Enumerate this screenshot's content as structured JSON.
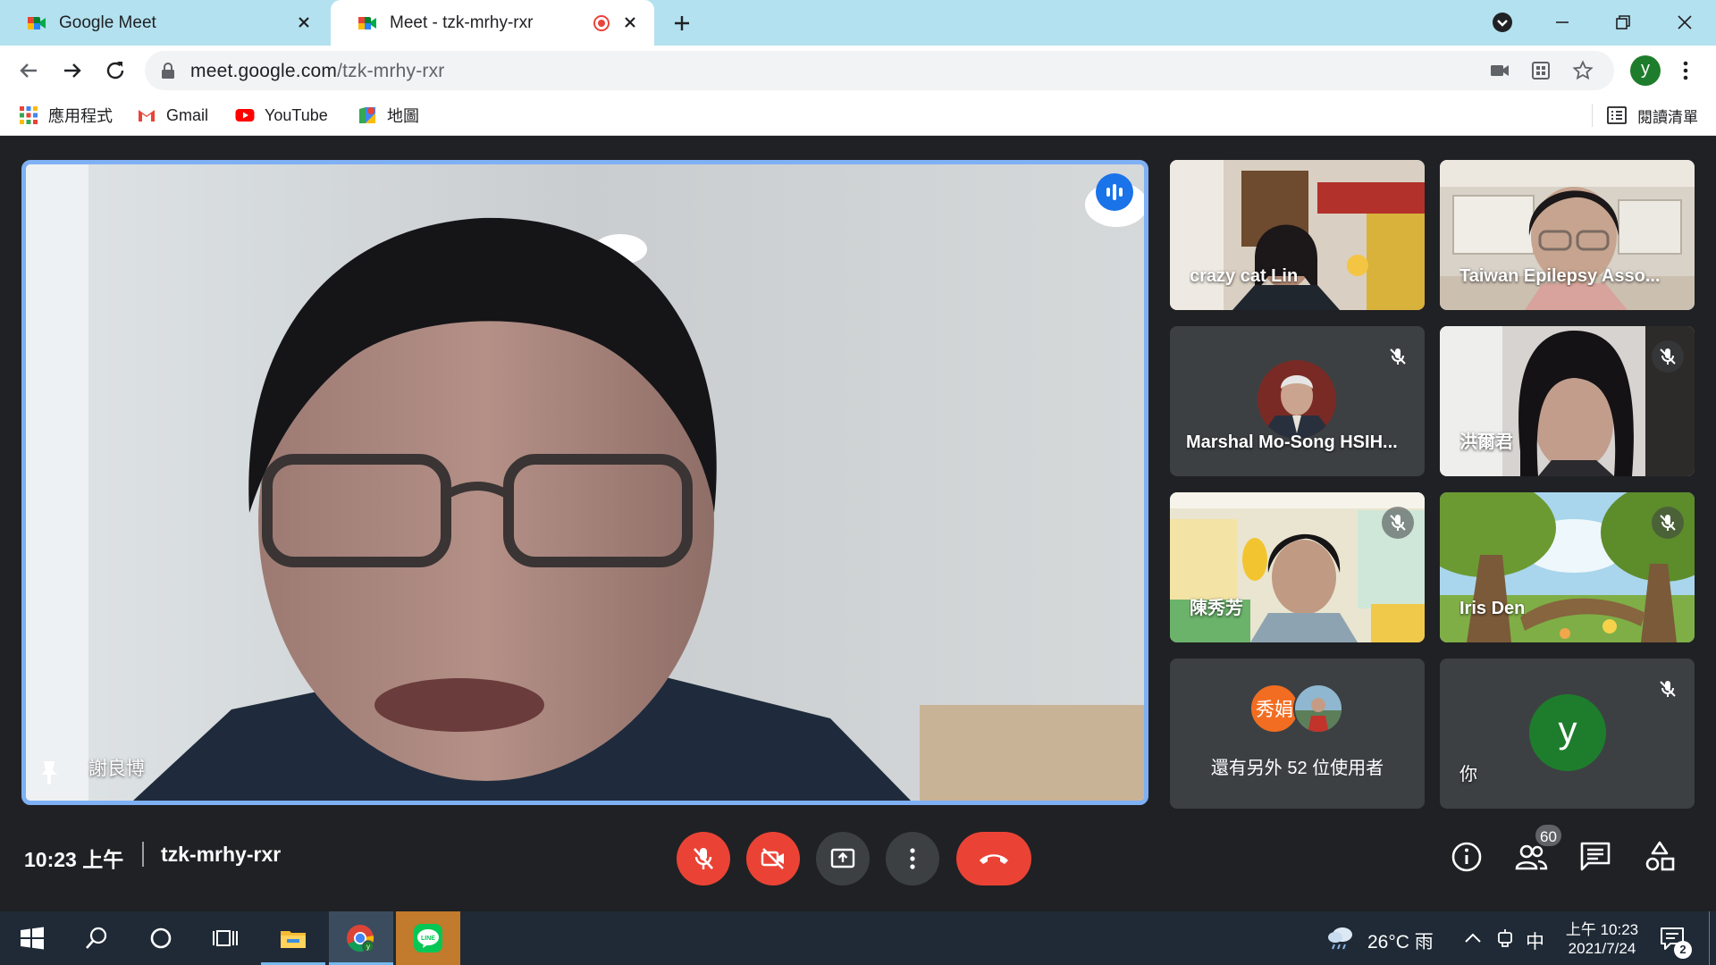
{
  "browser": {
    "tabs": [
      {
        "title": "Google Meet",
        "active": false
      },
      {
        "title": "Meet - tzk-mrhy-rxr",
        "active": true,
        "recording": true
      }
    ],
    "url_domain": "meet.google.com",
    "url_path": "/tzk-mrhy-rxr",
    "profile_initial": "y",
    "bookmarks": [
      {
        "label": "應用程式",
        "icon": "apps-grid-icon"
      },
      {
        "label": "Gmail",
        "icon": "gmail-icon"
      },
      {
        "label": "YouTube",
        "icon": "youtube-icon"
      },
      {
        "label": "地圖",
        "icon": "maps-icon"
      }
    ],
    "reading_list_label": "閱讀清單"
  },
  "meet": {
    "main_speaker": {
      "name": "謝良博"
    },
    "tiles": [
      {
        "name": "crazy cat Lin",
        "muted": false
      },
      {
        "name": "Taiwan Epilepsy Asso...",
        "muted": false
      },
      {
        "name": "Marshal Mo-Song HSIH...",
        "muted": true
      },
      {
        "name": "洪爾君",
        "muted": true
      },
      {
        "name": "陳秀芳",
        "muted": true
      },
      {
        "name": "Iris Den",
        "muted": true
      }
    ],
    "others": {
      "avatar_text": "秀娟",
      "label": "還有另外 52 位使用者"
    },
    "self": {
      "initial": "y",
      "label": "你",
      "muted": true
    },
    "time": "10:23 上午",
    "code": "tzk-mrhy-rxr",
    "participant_count": "60",
    "colors": {
      "accent": "#1a73e8",
      "danger": "#ea4335",
      "surface": "#3c4043",
      "background": "#202124"
    }
  },
  "taskbar": {
    "weather": "26°C 雨",
    "ime": "中",
    "time": "上午 10:23",
    "date": "2021/7/24",
    "notifications": "2"
  }
}
